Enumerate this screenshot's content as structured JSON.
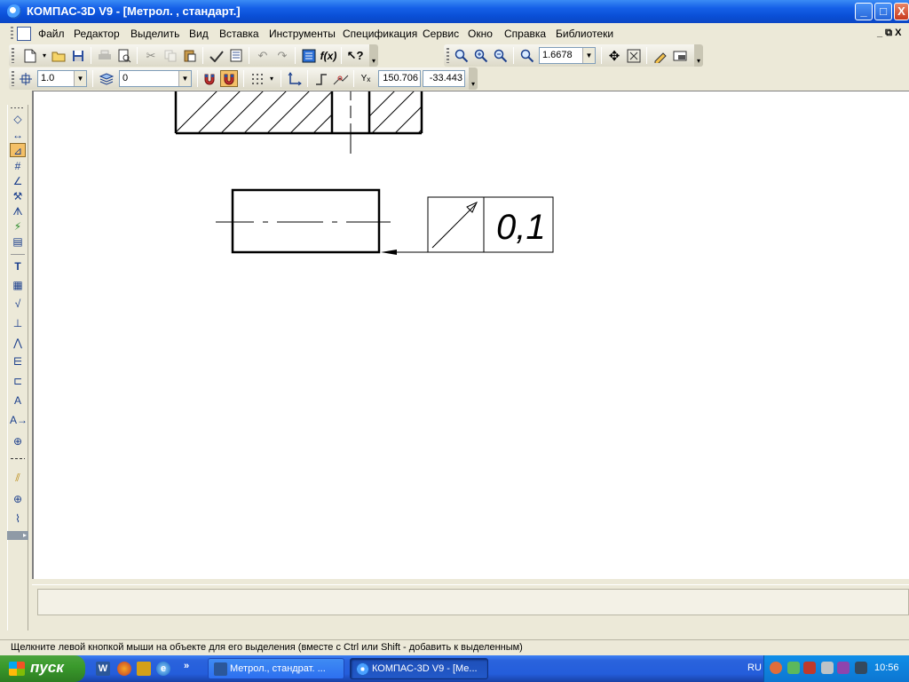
{
  "window": {
    "title": "КОМПАС-3D V9 - [Метрол. , стандарт.]",
    "controls": {
      "minimize": "_",
      "maximize": "□",
      "close": "X"
    }
  },
  "menu": {
    "items": [
      "Файл",
      "Редактор",
      "Выделить",
      "Вид",
      "Вставка",
      "Инструменты",
      "Спецификация",
      "Сервис",
      "Окно",
      "Справка",
      "Библиотеки"
    ],
    "mdi_controls": "_ ⧉ X"
  },
  "view_toolbar": {
    "zoom_value": "1.6678"
  },
  "current_state": {
    "step": "1.0",
    "layer": "0",
    "coord_x": "150.706",
    "coord_y": "-33.443"
  },
  "drawing": {
    "tolerance_value": "0,1"
  },
  "status": {
    "message": "Щелкните левой кнопкой мыши на объекте для его выделения (вместе с Ctrl или Shift - добавить к выделенным)"
  },
  "taskbar": {
    "start_label": "пуск",
    "quick_launch_more": "»",
    "tasks": [
      {
        "label": "Метрол., стандрат. ...",
        "active": false
      },
      {
        "label": "КОМПАС-3D V9 - [Ме...",
        "active": true
      }
    ],
    "language": "RU",
    "clock": "10:56"
  }
}
